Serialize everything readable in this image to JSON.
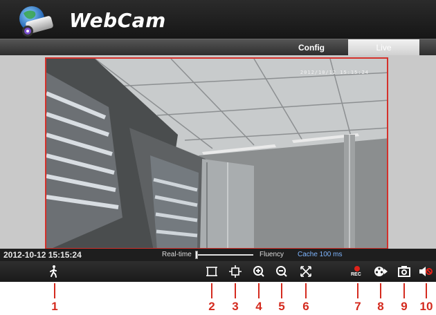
{
  "header": {
    "app_title": "WebCam",
    "logo_icon": "webcam-logo-icon"
  },
  "nav": {
    "tabs": [
      {
        "label": "Config"
      },
      {
        "label": "Live",
        "active": true
      }
    ]
  },
  "video": {
    "overlay_timestamp": "2012/10/12 15:15:24",
    "border_color": "#d4302a"
  },
  "status": {
    "datetime": "2012-10-12 15:15:24",
    "realtime_label": "Real-time",
    "fluency_label": "Fluency",
    "cache_label": "Cache 100 ms",
    "buffer_slider_value": 0
  },
  "toolbar": {
    "buttons": [
      {
        "icon": "motion-detection-icon"
      },
      {
        "icon": "fit-window-icon"
      },
      {
        "icon": "original-size-icon"
      },
      {
        "icon": "zoom-in-icon"
      },
      {
        "icon": "zoom-out-icon"
      },
      {
        "icon": "fullscreen-icon"
      },
      {
        "icon": "record-icon",
        "label": "REC"
      },
      {
        "icon": "playback-icon"
      },
      {
        "icon": "snapshot-icon"
      },
      {
        "icon": "mute-icon"
      }
    ]
  },
  "callouts": [
    "1",
    "2",
    "3",
    "4",
    "5",
    "6",
    "7",
    "8",
    "9",
    "10"
  ],
  "colors": {
    "accent_red": "#d42a1e",
    "header_bg": "#1f1f1f",
    "cache_text": "#7fb6ff"
  }
}
